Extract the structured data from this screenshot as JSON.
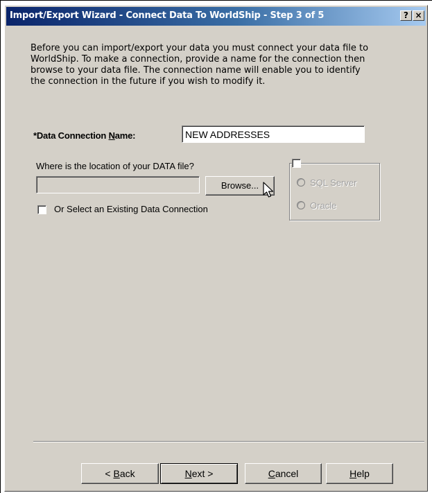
{
  "window": {
    "title": "Import/Export Wizard - Connect Data To WorldShip - Step 3 of 5",
    "help_button": "?",
    "close_button": "×"
  },
  "intro": {
    "text": "Before you can import/export your data you must connect your data file to WorldShip. To make a connection, provide a name for the connection then browse to your data file. The connection name will enable you to identify the connection in the future if you wish to modify it."
  },
  "connection": {
    "label_prefix": "*Data Connection ",
    "label_mnemonic": "N",
    "label_suffix": "ame:",
    "value": "NEW ADDRESSES"
  },
  "location": {
    "label": "Where is the location of your DATA file?",
    "path_value": "",
    "browse_label": "Browse..."
  },
  "existing": {
    "label": "Or Select an Existing Data Connection",
    "checked": false
  },
  "database_group": {
    "enabled": false,
    "options": [
      {
        "label": "SQL Server",
        "selected": false
      },
      {
        "label": "Oracle",
        "selected": false
      }
    ]
  },
  "buttons": {
    "back_mnemonic": "B",
    "back_rest": "ack",
    "back_prefix": "< ",
    "next_mnemonic": "N",
    "next_rest": "ext >",
    "cancel_mnemonic": "C",
    "cancel_rest": "ancel",
    "help_mnemonic": "H",
    "help_rest": "elp"
  },
  "colors": {
    "titlebar_start": "#0a246a",
    "titlebar_end": "#a6caf0",
    "face": "#d4d0c8"
  }
}
